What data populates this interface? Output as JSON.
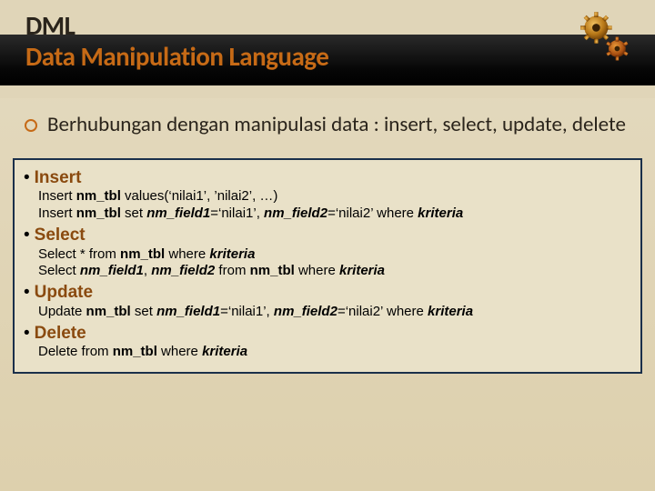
{
  "header": {
    "line1": "DML",
    "line2": "Data Manipulation Language"
  },
  "intro": "Berhubungan dengan manipulasi data : insert, select, update, delete",
  "sections": {
    "insert": {
      "title": "Insert",
      "lines": [
        {
          "plain": "Insert ",
          "b1": "nm_tbl",
          "rest": " values(‘nilai1’, ’nilai2’, …)"
        },
        {
          "plain": "Insert ",
          "b1": "nm_tbl",
          "mid": " set ",
          "bi1": "nm_field1",
          "eq1": "=‘nilai1’, ",
          "bi2": "nm_field2",
          "eq2": "=‘nilai2’ where ",
          "bi3": "kriteria"
        }
      ]
    },
    "select": {
      "title": "Select",
      "lines": [
        {
          "plain": "Select * from ",
          "b1": "nm_tbl",
          "mid": " where ",
          "bi1": "kriteria"
        },
        {
          "plain": "Select ",
          "bi1": "nm_field1",
          "c1": ", ",
          "bi2": "nm_field2",
          "mid": " from ",
          "b1": "nm_tbl",
          "mid2": " where ",
          "bi3": "kriteria"
        }
      ]
    },
    "update": {
      "title": "Update",
      "lines": [
        {
          "plain": "Update ",
          "b1": "nm_tbl",
          "mid": " set ",
          "bi1": "nm_field1",
          "eq1": "=‘nilai1’, ",
          "bi2": "nm_field2",
          "eq2": "=‘nilai2’ where ",
          "bi3": "kriteria"
        }
      ]
    },
    "delete": {
      "title": "Delete",
      "lines": [
        {
          "plain": "Delete from ",
          "b1": "nm_tbl",
          "mid": " where ",
          "bi1": "kriteria"
        }
      ]
    }
  }
}
